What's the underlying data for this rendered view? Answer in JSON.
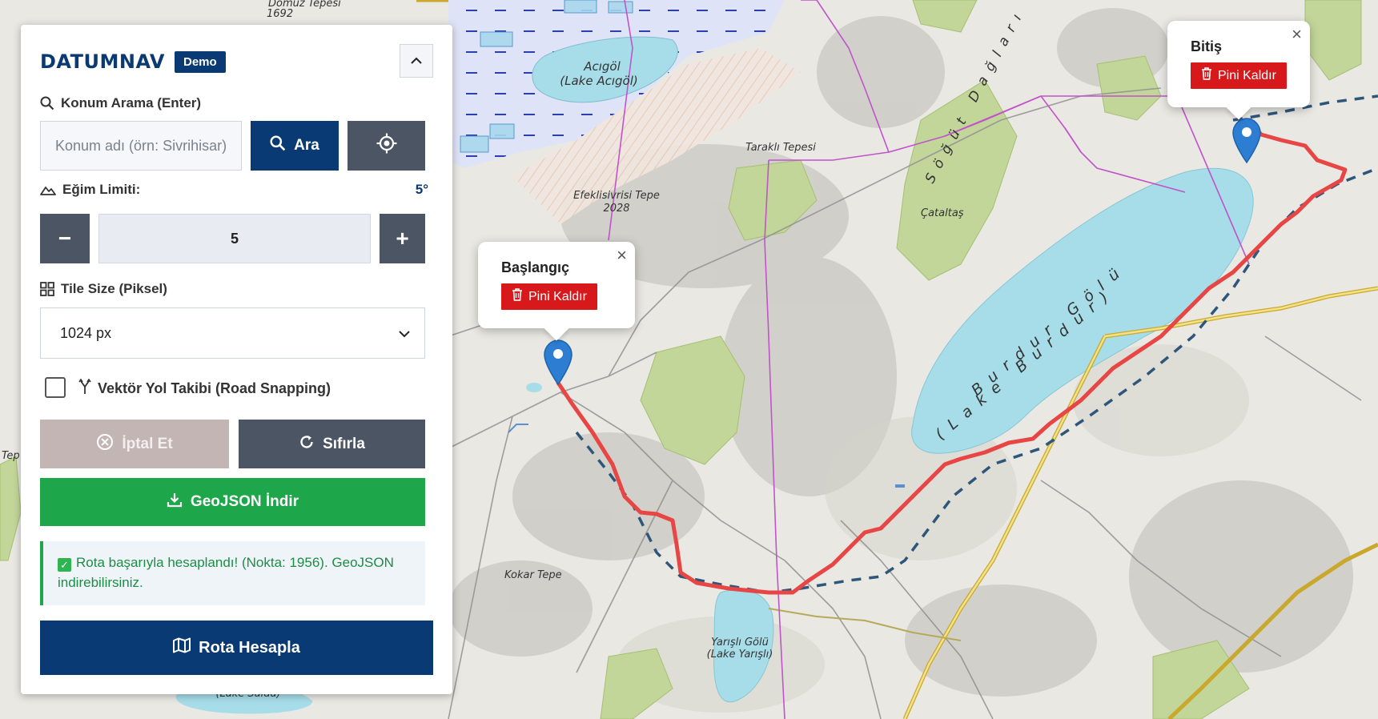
{
  "app": {
    "brand": "DATUMNAV",
    "badge": "Demo"
  },
  "search": {
    "label": "Konum Arama (Enter)",
    "placeholder": "Konum adı (örn: Sivrihisar)...",
    "value": "",
    "search_button": "Ara"
  },
  "slope": {
    "label": "Eğim Limiti:",
    "display_value": "5°",
    "stepper_value": "5",
    "minus": "−",
    "plus": "+"
  },
  "tile_size": {
    "label": "Tile Size (Piksel)",
    "selected": "1024 px"
  },
  "road_snapping": {
    "label": "Vektör Yol Takibi (Road Snapping)",
    "checked": false
  },
  "buttons": {
    "cancel": "İptal Et",
    "reset": "Sıfırla",
    "download": "GeoJSON İndir",
    "calculate": "Rota Hesapla"
  },
  "status": {
    "message": "Rota başarıyla hesaplandı! (Nokta: 1956). GeoJSON indirebilirsiniz."
  },
  "colors": {
    "brand": "#0a3a73",
    "slate": "#4b5563",
    "cancel_disabled": "#c4b5b5",
    "download": "#1ea64a",
    "route": "#e84545",
    "pin": "#2d7dd2",
    "remove_pin": "#d7191c",
    "lake": "#a7dde9"
  },
  "popups": {
    "start": {
      "title": "Başlangıç",
      "remove": "Pini Kaldır",
      "close": "×"
    },
    "end": {
      "title": "Bitiş",
      "remove": "Pini Kaldır",
      "close": "×"
    }
  },
  "map": {
    "labels": {
      "domuz_tepesi": "Domuz Tepesi",
      "domuz_elev": "1692",
      "acigol": "Acıgöl",
      "acigol_en": "(Lake Acıgöl)",
      "tarakli": "Taraklı Tepesi",
      "efeklisivrisi": "Efeklisivrisi Tepe",
      "efeklisivrisi_elev": "2028",
      "catalcas": "Çataltaş",
      "sogut": "Söğüt Dağları",
      "burdur": "Burdur Gölü",
      "burdur_en": "(Lake Burdur)",
      "kokar": "Kokar Tepe",
      "yarisli": "Yarışlı Gölü",
      "yarisli_en": "(Lake Yarışlı)",
      "salda_en": "(Lake Salda)",
      "left_edge": "Tep"
    }
  }
}
